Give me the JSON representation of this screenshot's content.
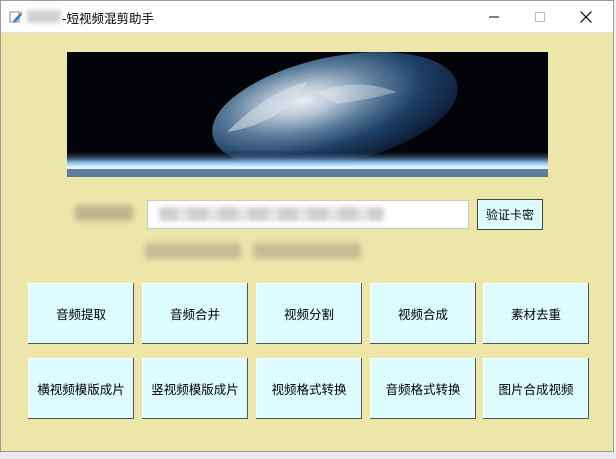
{
  "window": {
    "title": "-短视频混剪助手",
    "icon": "pen-app-icon",
    "controls": [
      "minimize-icon",
      "maximize-icon",
      "close-icon"
    ]
  },
  "colors": {
    "background": "#ece6a8",
    "button": "#dcfcff",
    "titlebar": "#ffffff"
  },
  "card": {
    "input_value": "",
    "verify_label": "验证卡密"
  },
  "buttons": {
    "row1": [
      "音频提取",
      "音频合并",
      "视频分割",
      "视频合成",
      "素材去重"
    ],
    "row2": [
      "横视频模版成片",
      "竖视频模版成片",
      "视频格式转换",
      "音频格式转换",
      "图片合成视频"
    ]
  }
}
